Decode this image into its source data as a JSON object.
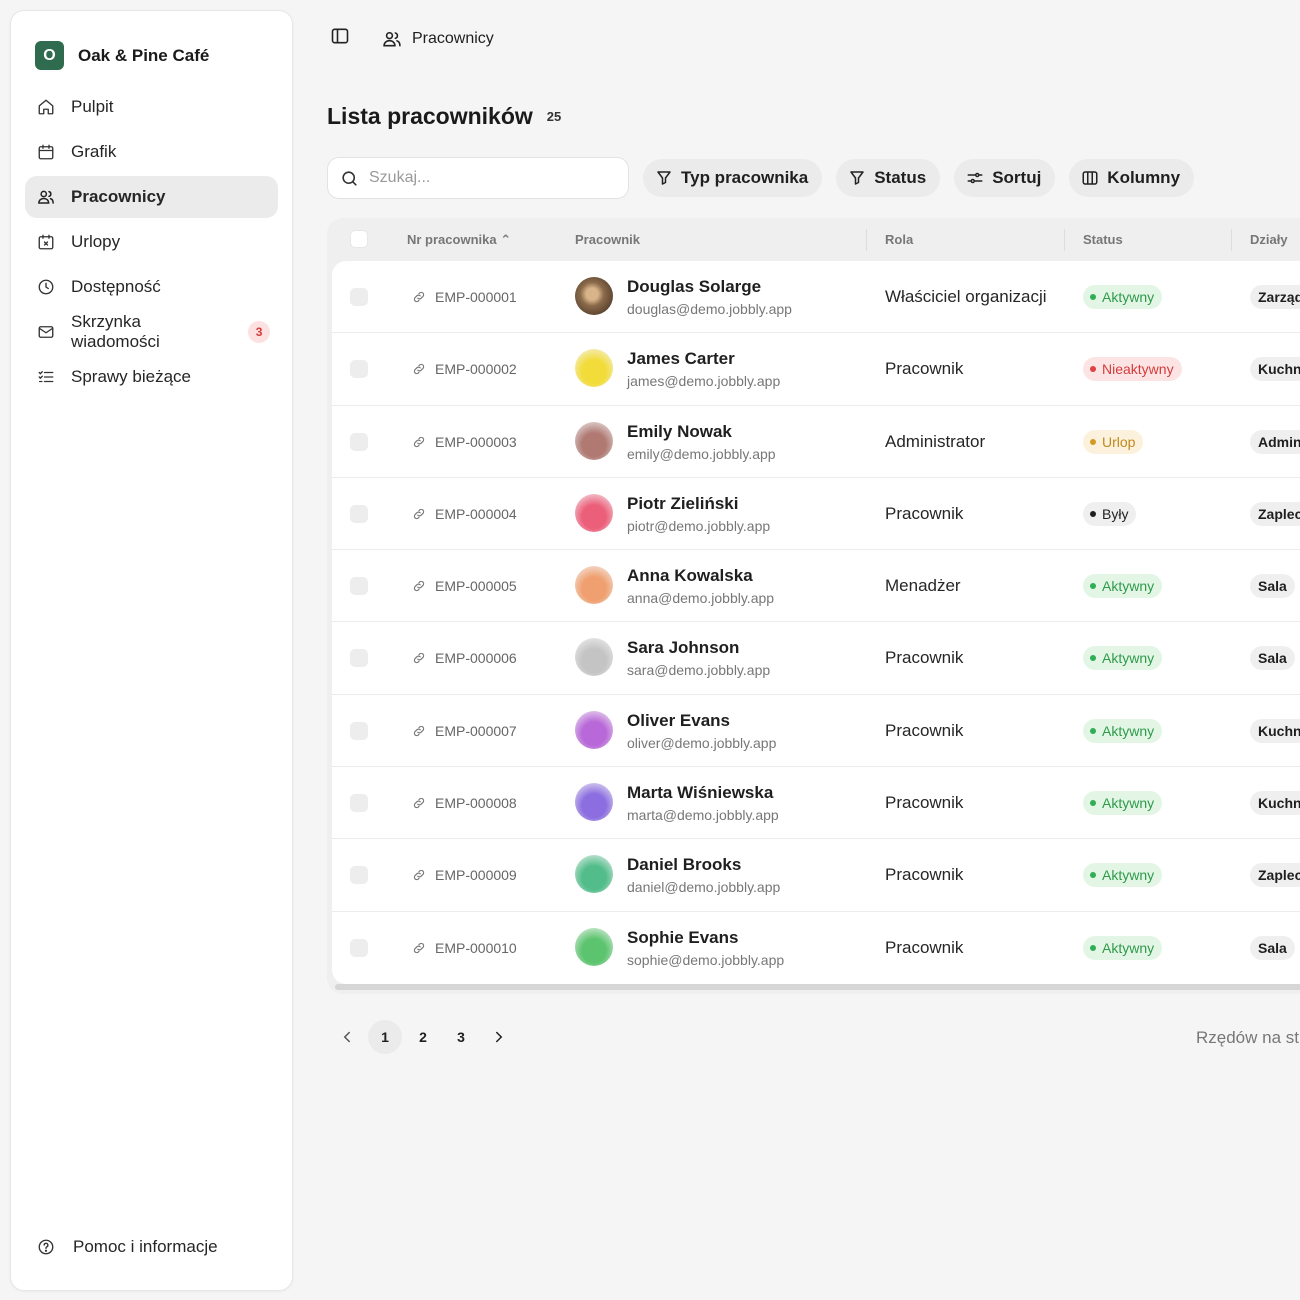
{
  "brand": {
    "initial": "O",
    "name": "Oak & Pine Café",
    "color": "#2f6b4f"
  },
  "sidebar": {
    "items": [
      {
        "label": "Pulpit",
        "icon": "home-icon"
      },
      {
        "label": "Grafik",
        "icon": "calendar-icon"
      },
      {
        "label": "Pracownicy",
        "icon": "users-icon",
        "active": true
      },
      {
        "label": "Urlopy",
        "icon": "calendar-x-icon"
      },
      {
        "label": "Dostępność",
        "icon": "clock-icon"
      },
      {
        "label": "Skrzynka wiadomości",
        "icon": "mail-icon",
        "badge": "3"
      },
      {
        "label": "Sprawy bieżące",
        "icon": "list-todo-icon"
      }
    ],
    "help": "Pomoc i informacje"
  },
  "header": {
    "breadcrumb": "Pracownicy"
  },
  "page": {
    "title": "Lista pracowników",
    "count": "25"
  },
  "toolbar": {
    "search_placeholder": "Szukaj...",
    "filter_type": "Typ pracownika",
    "filter_status": "Status",
    "sort": "Sortuj",
    "columns": "Kolumny"
  },
  "table": {
    "headers": {
      "number": "Nr pracownika",
      "employee": "Pracownik",
      "role": "Rola",
      "status": "Status",
      "departments": "Działy"
    },
    "rows": [
      {
        "id": "EMP-000001",
        "name": "Douglas Solarge",
        "email": "douglas@demo.jobbly.app",
        "role": "Właściciel organizacji",
        "status": "Aktywny",
        "status_kind": "active",
        "dept": "Zarząd",
        "avatar": "photo"
      },
      {
        "id": "EMP-000002",
        "name": "James Carter",
        "email": "james@demo.jobbly.app",
        "role": "Pracownik",
        "status": "Nieaktywny",
        "status_kind": "inactive",
        "dept": "Kuchnia",
        "avatar": "#f2dc3a"
      },
      {
        "id": "EMP-000003",
        "name": "Emily Nowak",
        "email": "emily@demo.jobbly.app",
        "role": "Administrator",
        "status": "Urlop",
        "status_kind": "leave",
        "dept": "Admin",
        "avatar": "#b07a73"
      },
      {
        "id": "EMP-000004",
        "name": "Piotr Zieliński",
        "email": "piotr@demo.jobbly.app",
        "role": "Pracownik",
        "status": "Były",
        "status_kind": "former",
        "dept": "Zaplecze",
        "avatar": "#ec5f7a"
      },
      {
        "id": "EMP-000005",
        "name": "Anna Kowalska",
        "email": "anna@demo.jobbly.app",
        "role": "Menadżer",
        "status": "Aktywny",
        "status_kind": "active",
        "dept": "Sala",
        "avatar": "#f0a070"
      },
      {
        "id": "EMP-000006",
        "name": "Sara Johnson",
        "email": "sara@demo.jobbly.app",
        "role": "Pracownik",
        "status": "Aktywny",
        "status_kind": "active",
        "dept": "Sala",
        "avatar": "#c4c4c4"
      },
      {
        "id": "EMP-000007",
        "name": "Oliver Evans",
        "email": "oliver@demo.jobbly.app",
        "role": "Pracownik",
        "status": "Aktywny",
        "status_kind": "active",
        "dept": "Kuchnia",
        "avatar": "#b868d8"
      },
      {
        "id": "EMP-000008",
        "name": "Marta Wiśniewska",
        "email": "marta@demo.jobbly.app",
        "role": "Pracownik",
        "status": "Aktywny",
        "status_kind": "active",
        "dept": "Kuchnia",
        "avatar": "#8c6ee0"
      },
      {
        "id": "EMP-000009",
        "name": "Daniel Brooks",
        "email": "daniel@demo.jobbly.app",
        "role": "Pracownik",
        "status": "Aktywny",
        "status_kind": "active",
        "dept": "Zaplecze",
        "avatar": "#52bd8a"
      },
      {
        "id": "EMP-000010",
        "name": "Sophie Evans",
        "email": "sophie@demo.jobbly.app",
        "role": "Pracownik",
        "status": "Aktywny",
        "status_kind": "active",
        "dept": "Sala",
        "avatar": "#5cc46e"
      }
    ]
  },
  "status_colors": {
    "active": {
      "bg": "#e3f6e6",
      "fg": "#2f9a4a",
      "dot": "#2fae55"
    },
    "inactive": {
      "bg": "#fde4e4",
      "fg": "#d43b3b",
      "dot": "#e0403f"
    },
    "leave": {
      "bg": "#fbf1dc",
      "fg": "#c08a1e",
      "dot": "#d19a25"
    },
    "former": {
      "bg": "#efefef",
      "fg": "#1f1f1f",
      "dot": "#1f1f1f"
    }
  },
  "pagination": {
    "pages": [
      "1",
      "2",
      "3"
    ],
    "current": "1",
    "rows_per_page_label": "Rzędów na str"
  }
}
